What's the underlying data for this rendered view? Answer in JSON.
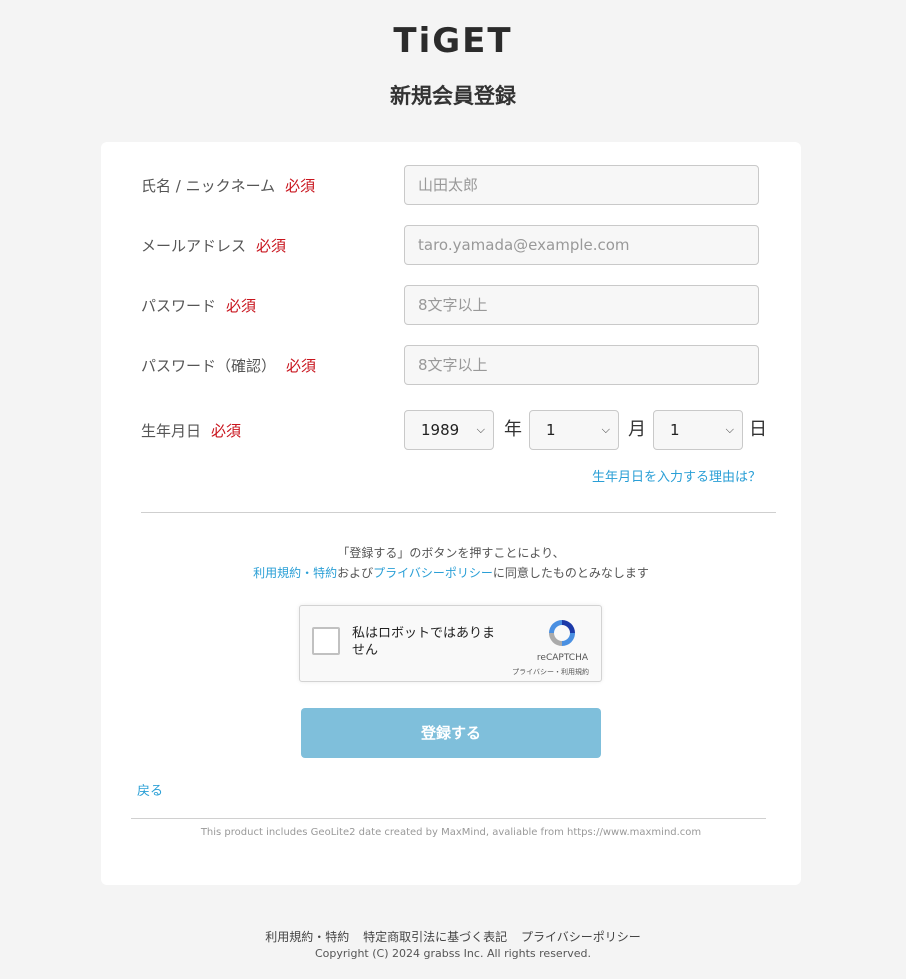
{
  "header": {
    "logo": "TiGET",
    "title": "新規会員登録"
  },
  "form": {
    "name": {
      "label": "氏名 / ニックネーム",
      "required": "必須",
      "placeholder": "山田太郎"
    },
    "email": {
      "label": "メールアドレス",
      "required": "必須",
      "placeholder": "taro.yamada@example.com"
    },
    "password": {
      "label": "パスワード",
      "required": "必須",
      "placeholder": "8文字以上"
    },
    "password_confirm": {
      "label": "パスワード（確認）",
      "required": "必須",
      "placeholder": "8文字以上"
    },
    "birthday": {
      "label": "生年月日",
      "required": "必須",
      "year": "1989",
      "year_unit": "年",
      "month": "1",
      "month_unit": "月",
      "day": "1",
      "day_unit": "日"
    },
    "birthday_reason_link": "生年月日を入力する理由は？"
  },
  "agreement": {
    "line1": "「登録する」のボタンを押すことにより、",
    "terms_link": "利用規約・特約",
    "and": "および",
    "privacy_link": "プライバシーポリシー",
    "suffix": "に同意したものとみなします"
  },
  "captcha": {
    "label": "私はロボットではありません",
    "brand": "reCAPTCHA",
    "terms": "プライバシー・利用規約"
  },
  "submit_label": "登録する",
  "back_label": "戻る",
  "geo_notice": "This product includes GeoLite2 date created by MaxMind, avaliable from https://www.maxmind.com",
  "footer": {
    "links": [
      "利用規約・特約",
      "特定商取引法に基づく表記",
      "プライバシーポリシー"
    ],
    "copyright": "Copyright (C) 2024 grabss Inc. All rights reserved."
  },
  "colors": {
    "required": "#c9151e",
    "link": "#2a9fd6",
    "submit_bg": "#7fbfdb",
    "logo_accent": "#3aa39b"
  }
}
